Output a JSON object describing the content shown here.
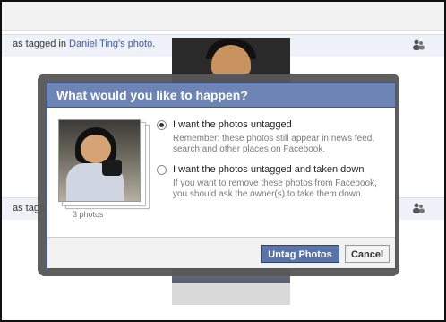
{
  "feed": {
    "row1": {
      "prefix": "as tagged in ",
      "link": "Daniel Ting's photo",
      "suffix": "."
    },
    "row2": {
      "prefix": "as tagg"
    }
  },
  "dialog": {
    "title": "What would you like to happen?",
    "thumbnail_caption": "3 photos",
    "options": [
      {
        "label": "I want the photos untagged",
        "description": "Remember: these photos still appear in news feed, search and other places on Facebook.",
        "selected": true
      },
      {
        "label": "I want the photos untagged and taken down",
        "description": "If you want to remove these photos from Facebook, you should ask the owner(s) to take them down.",
        "selected": false
      }
    ],
    "buttons": {
      "primary": "Untag Photos",
      "cancel": "Cancel"
    }
  },
  "icons": [
    "tag-people-icon"
  ],
  "colors": {
    "header": "#6d84b4",
    "link": "#3b5998",
    "primary_button": "#5b74a8"
  }
}
